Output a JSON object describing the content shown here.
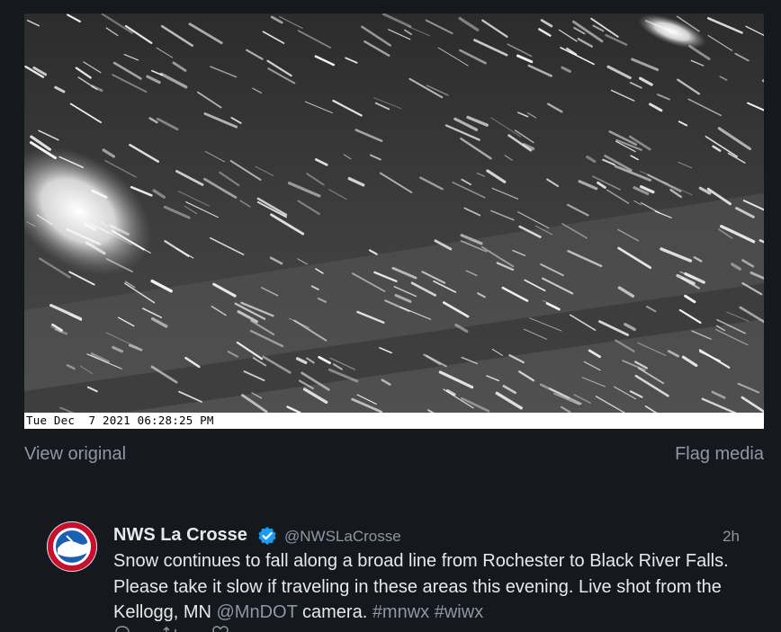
{
  "media": {
    "timestamp": "Tue Dec  7 2021 06:28:25 PM",
    "alt": "Live camera shot of heavy snow falling at night on a highway"
  },
  "media_actions": {
    "view_original": "View original",
    "flag_media": "Flag media"
  },
  "tweet": {
    "author_name": "NWS La Crosse",
    "handle": "@NWSLaCrosse",
    "time": "2h",
    "text_part1": "Snow continues to fall along a broad line from Rochester to Black River Falls. Please take it slow if traveling in these areas this evening. Live shot from the Kellogg, MN ",
    "mention": "@MnDOT",
    "text_part2": " camera. ",
    "hashtag1": "#mnwx",
    "hashtag2": "#wiwx",
    "avatar_icon": "nws-logo-icon",
    "verified_icon": "verified-badge-icon"
  },
  "colors": {
    "background": "#15181c",
    "text_primary": "#e7e9ea",
    "text_secondary": "#8b98a5",
    "verified": "#1d9bf0"
  }
}
